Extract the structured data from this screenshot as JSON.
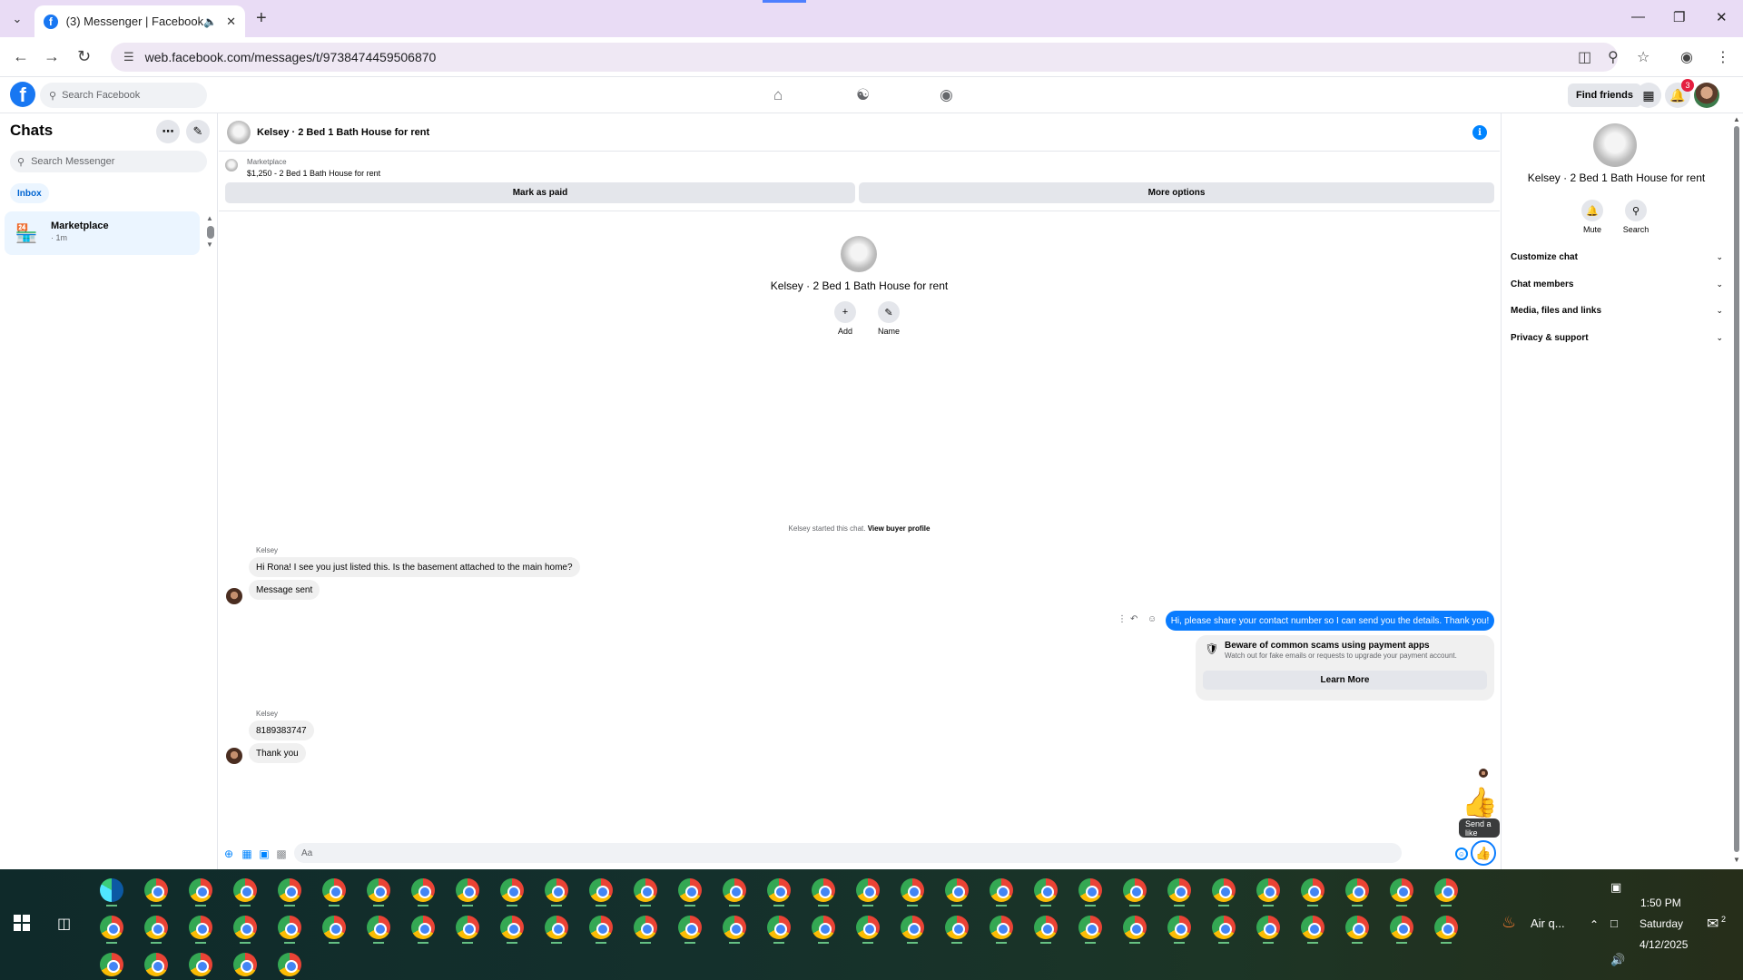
{
  "browser": {
    "tab_title": "(3) Messenger | Facebook",
    "url": "web.facebook.com/messages/t/9738474459506870"
  },
  "fb_header": {
    "search_placeholder": "Search Facebook",
    "find_friends": "Find friends",
    "notification_count": "3"
  },
  "chats": {
    "title": "Chats",
    "search_placeholder": "Search Messenger",
    "filter_inbox": "Inbox",
    "items": [
      {
        "name": "Marketplace",
        "time": "· 1m"
      }
    ]
  },
  "conversation": {
    "title": "Kelsey · 2 Bed 1 Bath House for rent",
    "listing_label": "Marketplace",
    "listing_price": "$1,250 - 2 Bed 1 Bath House for rent",
    "mark_paid": "Mark as paid",
    "more_options": "More options",
    "profile_name": "Kelsey · 2 Bed 1 Bath House for rent",
    "add_label": "Add",
    "name_label": "Name",
    "started_text": "Kelsey started this chat.",
    "view_profile": "View buyer profile",
    "messages": [
      {
        "sender": "Kelsey",
        "text": "Hi Rona! I see you just listed this. Is the basement attached to the main home?"
      },
      {
        "text": "Message sent"
      },
      {
        "outgoing": true,
        "text": "Hi, please share your contact number so I can send you the details. Thank you!"
      },
      {
        "sender": "Kelsey",
        "text": "8189383747"
      },
      {
        "text": "Thank you"
      }
    ],
    "scam_title": "Beware of common scams using payment apps",
    "scam_desc": "Watch out for fake emails or requests to upgrade your payment account.",
    "learn_more": "Learn More",
    "send_like_tooltip": "Send a like",
    "composer_placeholder": "Aa"
  },
  "info_panel": {
    "name": "Kelsey · 2 Bed 1 Bath House for rent",
    "mute": "Mute",
    "search": "Search",
    "sections": [
      "Customize chat",
      "Chat members",
      "Media, files and links",
      "Privacy & support"
    ]
  },
  "taskbar": {
    "weather": "Air q...",
    "time": "1:50 PM",
    "day": "Saturday",
    "date": "4/12/2025",
    "notif_count": "2"
  }
}
